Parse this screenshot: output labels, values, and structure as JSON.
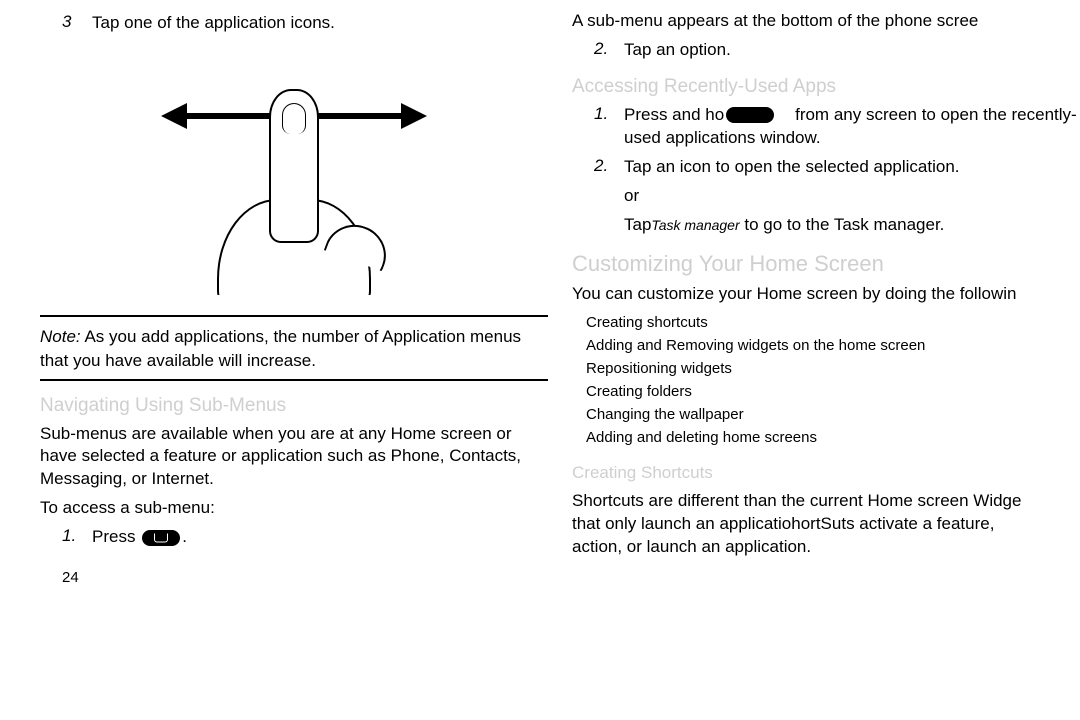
{
  "left": {
    "step3_num": "3",
    "step3_txt": "Tap one of the application icons.",
    "note_lbl": "Note:",
    "note_txt": "As you add applications, the number of Application menus that you have available will increase.",
    "h_submenus": "Navigating Using Sub-Menus",
    "submenus_p": "Sub-menus are available when you are at any Home screen or have selected a feature or application such as Phone, Contacts, Messaging, or Internet.",
    "access_p": "To access a sub-menu:",
    "step1_num": "1.",
    "step1_txt_a": "Press",
    "step1_txt_b": ".",
    "pagenum": "24"
  },
  "right": {
    "top_p": "A sub-menu appears at the bottom of the phone scree",
    "step2_num": "2.",
    "step2_txt": "Tap an option.",
    "h_recent": "Accessing Recently-Used Apps",
    "r_step1_num": "1.",
    "r_step1_a": "Press and ho",
    "r_step1_b": "from any screen to open the recently-used applications window.",
    "r_step2_num": "2.",
    "r_step2_txt": "Tap an icon to open the selected application.",
    "r_or": "or",
    "r_tap_a": "Tap",
    "r_tap_b": "Task manager",
    "r_tap_c": " to go to the Task manager.",
    "h_custom": "Customizing Your Home Screen",
    "custom_p": "You can customize your Home screen by doing the followin",
    "bullets": {
      "b1": "Creating shortcuts",
      "b2": "Adding and Removing widgets on the home screen",
      "b3": "Repositioning widgets",
      "b4": "Creating folders",
      "b5": "Changing the wallpaper",
      "b6": "Adding and deleting home screens"
    },
    "h_shortcuts": "Creating Shortcuts",
    "shortcuts_p1a": "Shortcuts are different than the current Home screen Widge",
    "shortcuts_p1b": "that only launch an applicatiohortSuts activate a feature,",
    "shortcuts_p1c": "action, or launch an application."
  }
}
